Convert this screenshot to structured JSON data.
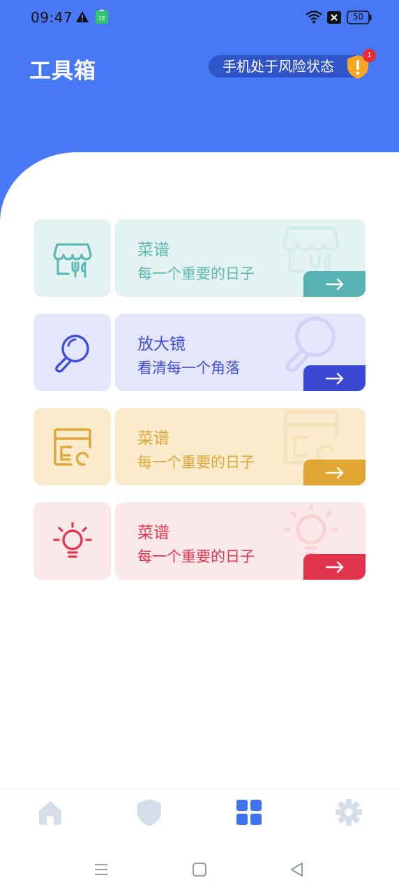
{
  "status_bar": {
    "time": "09:47",
    "battery": "50",
    "icons": [
      "warning-icon",
      "sim-notification-icon",
      "wifi-icon",
      "no-signal-icon",
      "battery-icon"
    ]
  },
  "header": {
    "title": "工具箱",
    "risk_text": "手机处于风险状态",
    "badge_count": "1"
  },
  "cards": [
    {
      "title": "菜谱",
      "subtitle": "每一个重要的日子",
      "icon": "storefront-utensils-icon",
      "accent": "#5cb8b2",
      "bg": "#e4f3f1"
    },
    {
      "title": "放大镜",
      "subtitle": "看清每一个角落",
      "icon": "magnifier-icon",
      "accent": "#3f4fd6",
      "bg": "#e5e6fb"
    },
    {
      "title": "菜谱",
      "subtitle": "每一个重要的日子",
      "icon": "recipe-card-icon",
      "accent": "#e0a63a",
      "bg": "#f9ebcc"
    },
    {
      "title": "菜谱",
      "subtitle": "每一个重要的日子",
      "icon": "lightbulb-icon",
      "accent": "#e3374f",
      "bg": "#fbe9ea"
    }
  ],
  "tabbar": {
    "tabs": [
      "home-icon",
      "shield-icon",
      "grid-icon",
      "settings-icon"
    ],
    "active_index": 2,
    "active_color": "#3f74f0",
    "inactive_color": "#d5dde8"
  },
  "navbar": [
    "menu-icon",
    "home-square-icon",
    "back-triangle-icon"
  ]
}
